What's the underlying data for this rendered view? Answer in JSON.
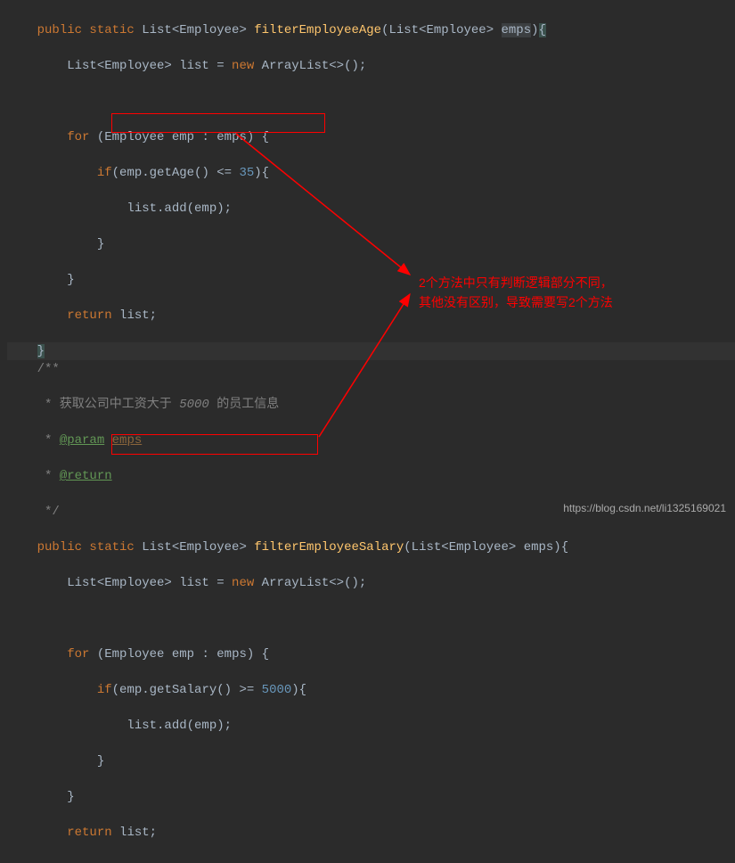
{
  "code": {
    "l1": "    public static List<Employee> filterEmployeeAge(List<Employee> emps){",
    "l2": "        List<Employee> list = new ArrayList<>();",
    "l3": "",
    "l4": "        for (Employee emp : emps) {",
    "l5": "            if(emp.getAge() <= 35){",
    "l6": "                list.add(emp);",
    "l7": "            }",
    "l8": "        }",
    "l9": "        return list;",
    "l10": "    }",
    "l11": "    /**",
    "l12": "     * 获取公司中工资大于 5000 的员工信息",
    "l13": "     * @param emps",
    "l14": "     * @return",
    "l15": "     */",
    "l16": "    public static List<Employee> filterEmployeeSalary(List<Employee> emps){",
    "l17": "        List<Employee> list = new ArrayList<>();",
    "l18": "",
    "l19": "        for (Employee emp : emps) {",
    "l20": "            if(emp.getSalary() >= 5000){",
    "l21": "                list.add(emp);",
    "l22": "            }",
    "l23": "        }",
    "l24": "        return list;"
  },
  "annotation": {
    "line1": "2个方法中只有判断逻辑部分不同，",
    "line2": "其他没有区别，导致需要写2个方法"
  },
  "watermark": "https://blog.csdn.net/li1325169021",
  "highlights": {
    "condition1": "emp.getAge() <= 35",
    "condition2": "emp.getSalary() >= 5000",
    "value35": "35",
    "value5000": "5000"
  }
}
